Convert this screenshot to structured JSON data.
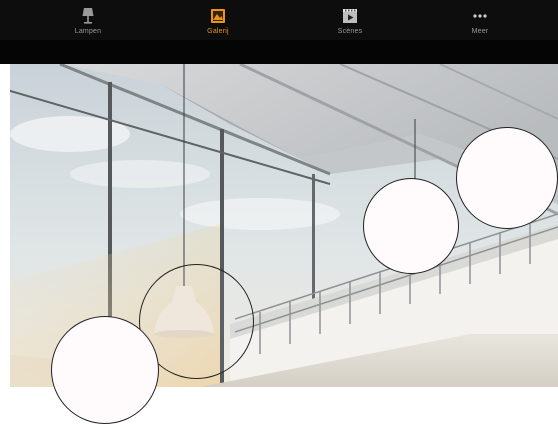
{
  "tabs": [
    {
      "label": "Lampen",
      "icon": "lamp-icon",
      "active": false
    },
    {
      "label": "Galerij",
      "icon": "gallery-icon",
      "active": true
    },
    {
      "label": "Scènes",
      "icon": "scenes-icon",
      "active": false
    },
    {
      "label": "Meer",
      "icon": "more-icon",
      "active": false
    }
  ],
  "colors": {
    "active": "#e8941a",
    "inactive": "#9a9a9a",
    "bar": "#0d0d0d"
  },
  "gallery": {
    "image": "interior-photo",
    "lamp_markers": 4
  }
}
